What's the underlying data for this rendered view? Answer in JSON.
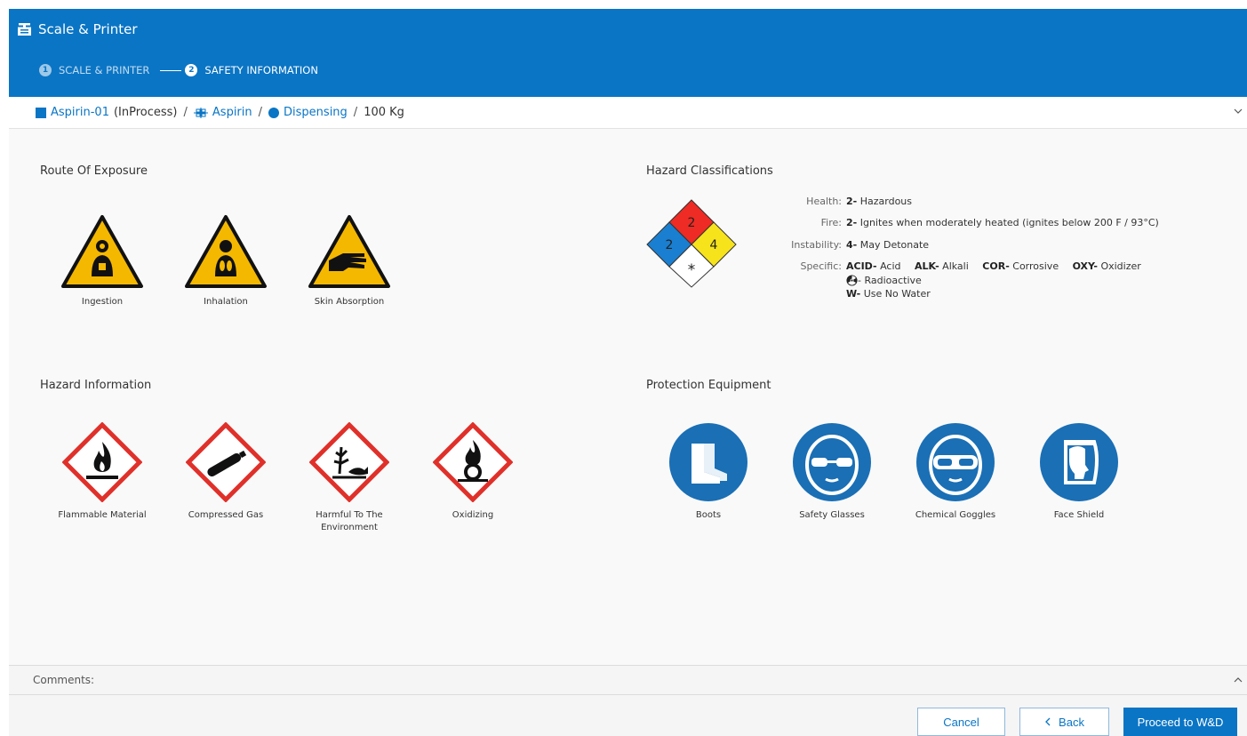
{
  "app": {
    "title": "Scale & Printer"
  },
  "stepper": {
    "steps": [
      {
        "num": "1",
        "label": "SCALE & PRINTER"
      },
      {
        "num": "2",
        "label": "SAFETY INFORMATION"
      }
    ]
  },
  "breadcrumb": {
    "item1": "Aspirin-01",
    "item1_status": "(InProcess)",
    "item2": "Aspirin",
    "item3": "Dispensing",
    "quantity": "100 Kg",
    "sep": "/"
  },
  "route_of_exposure": {
    "title": "Route Of Exposure",
    "items": [
      {
        "label": "Ingestion",
        "icon": "ingestion-warning-icon"
      },
      {
        "label": "Inhalation",
        "icon": "inhalation-warning-icon"
      },
      {
        "label": "Skin Absorption",
        "icon": "skin-absorption-warning-icon"
      }
    ]
  },
  "hazard_classifications": {
    "title": "Hazard Classifications",
    "diamond": {
      "health": "2",
      "fire": "2",
      "instability": "4",
      "specific": "*"
    },
    "health_label": "Health:",
    "health_num": "2-",
    "health_text": "Hazardous",
    "fire_label": "Fire:",
    "fire_num": "2-",
    "fire_text": "Ignites when moderately heated (ignites below 200 F / 93°C)",
    "instability_label": "Instability:",
    "instability_num": "4-",
    "instability_text": "May Detonate",
    "specific_label": "Specific:",
    "specific": [
      {
        "code": "ACID-",
        "text": "Acid"
      },
      {
        "code": "ALK-",
        "text": "Alkali"
      },
      {
        "code": "COR-",
        "text": "Corrosive"
      },
      {
        "code": "OXY-",
        "text": "Oxidizer"
      },
      {
        "code": "",
        "text": "- Radioactive"
      },
      {
        "code": "W-",
        "text": "Use No Water"
      }
    ]
  },
  "hazard_information": {
    "title": "Hazard Information",
    "items": [
      {
        "label": "Flammable Material",
        "icon": "flammable-icon"
      },
      {
        "label": "Compressed Gas",
        "icon": "gas-cylinder-icon"
      },
      {
        "label": "Harmful To The Environment",
        "icon": "environment-hazard-icon"
      },
      {
        "label": "Oxidizing",
        "icon": "oxidizing-icon"
      }
    ]
  },
  "protection_equipment": {
    "title": "Protection Equipment",
    "items": [
      {
        "label": "Boots",
        "icon": "boots-icon"
      },
      {
        "label": "Safety Glasses",
        "icon": "safety-glasses-icon"
      },
      {
        "label": "Chemical Goggles",
        "icon": "chemical-goggles-icon"
      },
      {
        "label": "Face Shield",
        "icon": "face-shield-icon"
      }
    ]
  },
  "comments": {
    "label": "Comments:"
  },
  "footer": {
    "cancel": "Cancel",
    "back": "Back",
    "proceed": "Proceed to W&D"
  },
  "colors": {
    "header": "#0a75c5",
    "accent": "#0a75c5",
    "warning_yellow": "#f5b800",
    "ghs_red": "#e0302a",
    "nfpa_red": "#ee2b24",
    "nfpa_blue": "#1a7fd0",
    "nfpa_yellow": "#f7e31b"
  }
}
